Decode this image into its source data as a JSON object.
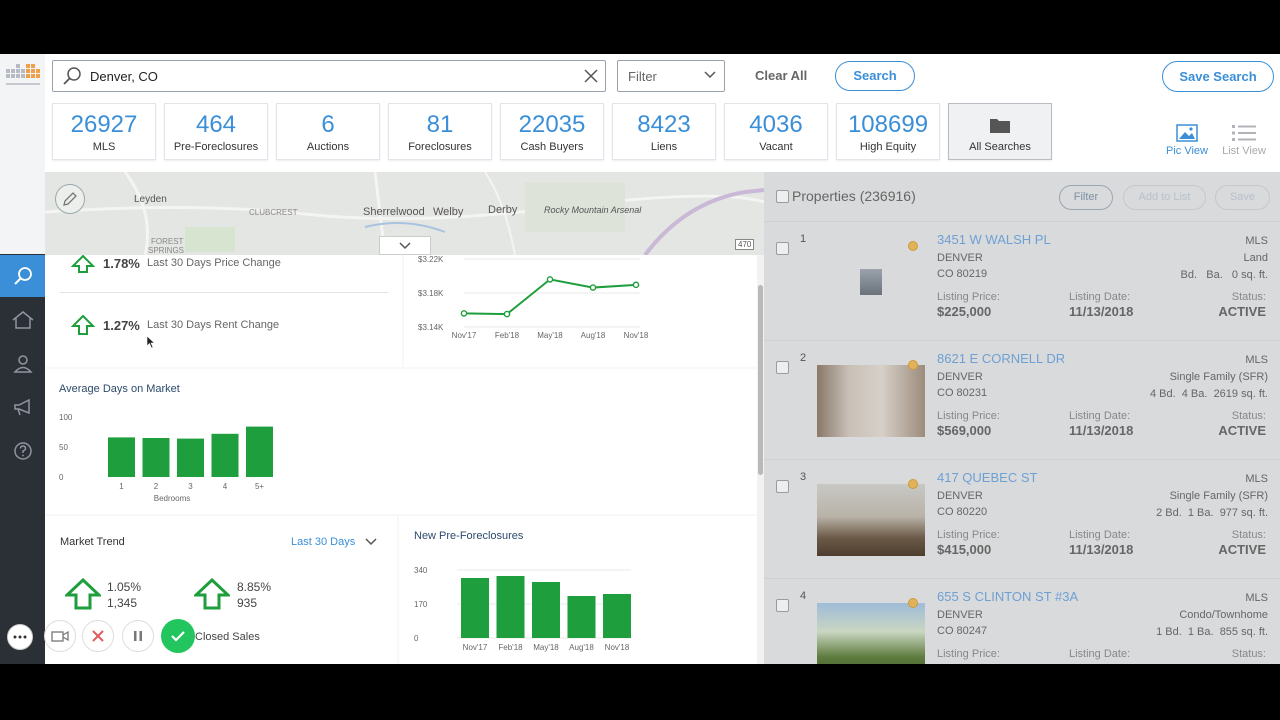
{
  "search": {
    "value": "Denver, CO",
    "filter_label": "Filter",
    "clear_all": "Clear All",
    "search_button": "Search",
    "save_search": "Save Search"
  },
  "stats": [
    {
      "value": "26927",
      "label": "MLS"
    },
    {
      "value": "464",
      "label": "Pre-Foreclosures"
    },
    {
      "value": "6",
      "label": "Auctions"
    },
    {
      "value": "81",
      "label": "Foreclosures"
    },
    {
      "value": "22035",
      "label": "Cash Buyers"
    },
    {
      "value": "8423",
      "label": "Liens"
    },
    {
      "value": "4036",
      "label": "Vacant"
    },
    {
      "value": "108699",
      "label": "High Equity"
    }
  ],
  "all_searches": "All Searches",
  "views": {
    "pic": "Pic View",
    "list": "List View"
  },
  "map_labels": {
    "leyden": "Leyden",
    "clubcrest": "CLUBCREST",
    "sherrelwood": "Sherrelwood",
    "welby": "Welby",
    "derby": "Derby",
    "arsenal": "Rocky Mountain Arsenal",
    "forest1": "FOREST",
    "forest2": "SPRINGS",
    "route": "470"
  },
  "changes": {
    "price": {
      "pct": "1.78%",
      "label": "Last 30 Days Price Change"
    },
    "rent": {
      "pct": "1.27%",
      "label": "Last 30 Days Rent Change"
    }
  },
  "price_chart": {
    "y_ticks": [
      "$3.22K",
      "$3.18K",
      "$3.14K"
    ],
    "x_labels": [
      "Nov'17",
      "Feb'18",
      "May'18",
      "Aug'18",
      "Nov'18"
    ]
  },
  "days_on_market": {
    "title": "Average Days on Market",
    "y_ticks": [
      "100",
      "50",
      "0"
    ],
    "xlabel": "Bedrooms"
  },
  "market_trend": {
    "title": "Market Trend",
    "range": "Last 30 Days",
    "a_pct": "1.05%",
    "a_count": "1,345",
    "b_pct": "8.85%",
    "b_count": "935",
    "closed_label": "Closed Sales"
  },
  "preforeclosures": {
    "title": "New Pre-Foreclosures",
    "y_ticks": [
      "340",
      "170",
      "0"
    ]
  },
  "chart_data": [
    {
      "type": "line",
      "title": "",
      "x": [
        "Nov'17",
        "Feb'18",
        "May'18",
        "Aug'18",
        "Nov'18"
      ],
      "y": [
        3.14,
        3.139,
        3.19,
        3.178,
        3.182
      ],
      "ylim": [
        3.12,
        3.22
      ],
      "ylabel": ""
    },
    {
      "type": "bar",
      "title": "Average Days on Market",
      "categories": [
        "1",
        "2",
        "3",
        "4",
        "5+"
      ],
      "values": [
        66,
        65,
        64,
        72,
        84
      ],
      "ylim": [
        0,
        100
      ],
      "xlabel": "Bedrooms"
    },
    {
      "type": "bar",
      "title": "New Pre-Foreclosures",
      "categories": [
        "Nov'17",
        "Feb'18",
        "May'18",
        "Aug'18",
        "Nov'18"
      ],
      "values": [
        300,
        310,
        280,
        210,
        220
      ],
      "ylim": [
        0,
        340
      ]
    }
  ],
  "properties": {
    "title": "Properties (236916)",
    "filter": "Filter",
    "add_to_list": "Add to List",
    "save": "Save",
    "listing_price_label": "Listing Price:",
    "listing_date_label": "Listing Date:",
    "status_label": "Status:",
    "items": [
      {
        "idx": "1",
        "address": "3451 W WALSH PL",
        "city": "DENVER",
        "zip": "CO 80219",
        "source": "MLS",
        "type": "Land",
        "beds": "Bd.",
        "baths": "Ba.",
        "sqft": "0 sq. ft.",
        "price": "$225,000",
        "date": "11/13/2018",
        "status": "ACTIVE"
      },
      {
        "idx": "2",
        "address": "8621 E CORNELL DR",
        "city": "DENVER",
        "zip": "CO 80231",
        "source": "MLS",
        "type": "Single Family (SFR)",
        "beds": "4 Bd.",
        "baths": "4 Ba.",
        "sqft": "2619 sq. ft.",
        "price": "$569,000",
        "date": "11/13/2018",
        "status": "ACTIVE"
      },
      {
        "idx": "3",
        "address": "417 QUEBEC ST",
        "city": "DENVER",
        "zip": "CO 80220",
        "source": "MLS",
        "type": "Single Family (SFR)",
        "beds": "2 Bd.",
        "baths": "1 Ba.",
        "sqft": "977 sq. ft.",
        "price": "$415,000",
        "date": "11/13/2018",
        "status": "ACTIVE"
      },
      {
        "idx": "4",
        "address": "655 S CLINTON ST #3A",
        "city": "DENVER",
        "zip": "CO 80247",
        "source": "MLS",
        "type": "Condo/Townhome",
        "beds": "1 Bd.",
        "baths": "1 Ba.",
        "sqft": "855 sq. ft.",
        "price": "Listing Price:",
        "date": "Listing Date:",
        "status": "Status:"
      }
    ]
  },
  "colors": {
    "accent": "#3a8fd8",
    "green": "#1e9e3c",
    "nav": "#2b2f36"
  }
}
